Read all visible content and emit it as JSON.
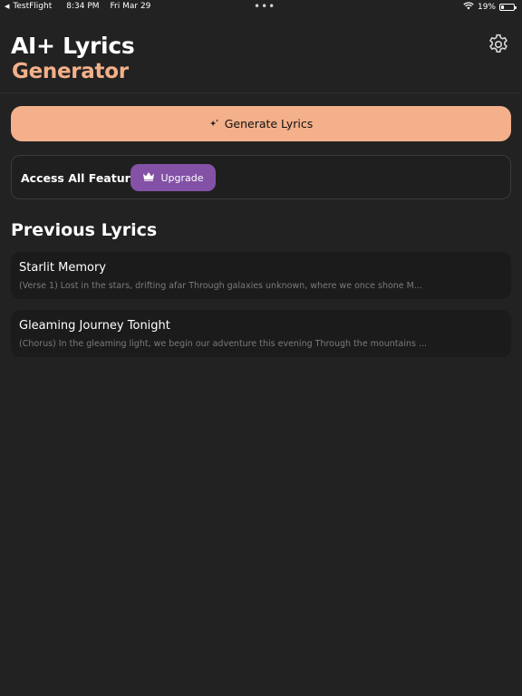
{
  "status_bar": {
    "back_arrow": "◀",
    "app": "TestFlight",
    "time": "8:34 PM",
    "date": "Fri Mar 29",
    "dots": "•••",
    "battery_text": "19%",
    "battery_level": 0.19
  },
  "header": {
    "title_line1": "AI+ Lyrics",
    "title_line2": "Generator",
    "accent_color": "#f3b08a",
    "settings_icon": "gear-icon"
  },
  "generate": {
    "label": "Generate Lyrics",
    "icon": "sparkle-icon"
  },
  "features": {
    "label": "Access All Features",
    "upgrade_label": "Upgrade",
    "upgrade_icon": "crown-icon",
    "upgrade_color": "#8351a6"
  },
  "previous": {
    "title": "Previous Lyrics",
    "items": [
      {
        "title": "Starlit Memory",
        "snippet": "(Verse 1) Lost in the stars, drifting afar Through galaxies unknown, where we once shone M..."
      },
      {
        "title": "Gleaming Journey Tonight",
        "snippet": "(Chorus) In the gleaming light, we begin our adventure this evening Through the mountains ..."
      }
    ]
  }
}
